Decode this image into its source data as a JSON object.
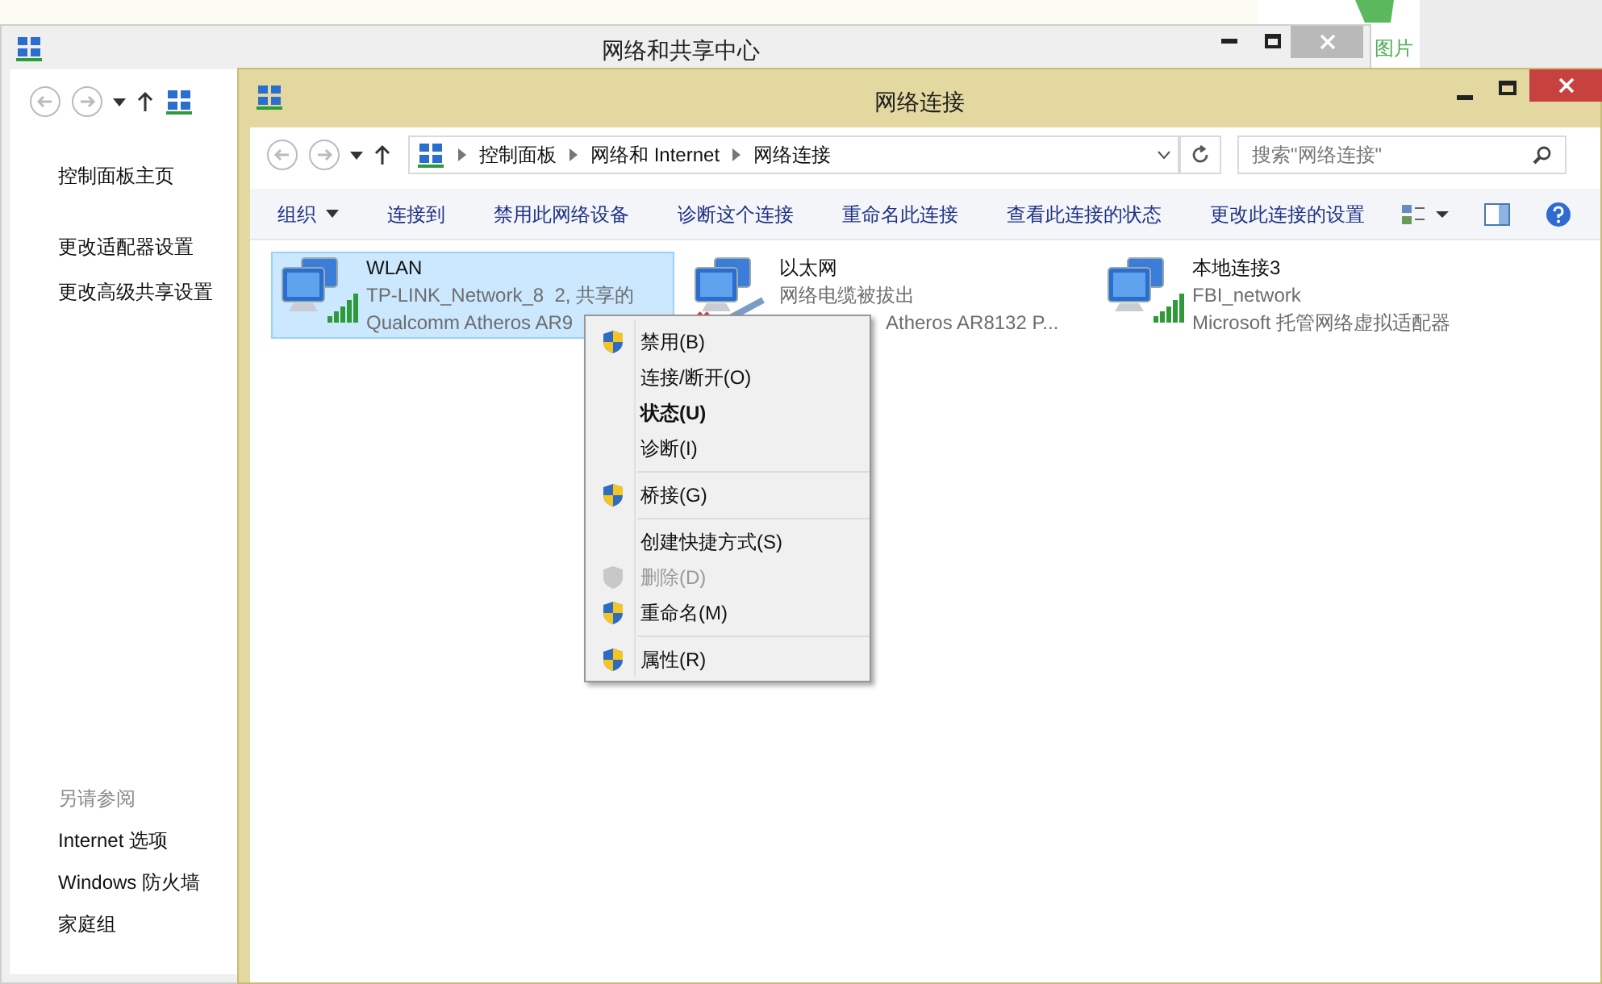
{
  "desktop": {
    "side_label": "图片"
  },
  "back_window": {
    "title": "网络和共享中心",
    "links": [
      "控制面板主页",
      "更改适配器设置",
      "更改高级共享设置"
    ],
    "see_also_heading": "另请参阅",
    "see_also": [
      "Internet 选项",
      "Windows 防火墙",
      "家庭组"
    ]
  },
  "window": {
    "title": "网络连接",
    "breadcrumb": [
      "控制面板",
      "网络和 Internet",
      "网络连接"
    ],
    "search": {
      "placeholder": "搜索\"网络连接\""
    },
    "toolbar": [
      {
        "label": "组织",
        "dropdown": true
      },
      {
        "label": "连接到",
        "dropdown": false
      },
      {
        "label": "禁用此网络设备",
        "dropdown": false
      },
      {
        "label": "诊断这个连接",
        "dropdown": false
      },
      {
        "label": "重命名此连接",
        "dropdown": false
      },
      {
        "label": "查看此连接的状态",
        "dropdown": false
      },
      {
        "label": "更改此连接的设置",
        "dropdown": false
      }
    ],
    "connections": [
      {
        "name": "WLAN",
        "status": "TP-LINK_Network_8  2, 共享的",
        "adapter": "Qualcomm Atheros AR9",
        "kind": "wireless",
        "selected": true
      },
      {
        "name": "以太网",
        "status": "网络电缆被拔出",
        "adapter": "Atheros AR8132 P...",
        "kind": "unplugged",
        "selected": false
      },
      {
        "name": "本地连接3",
        "status": "FBI_network",
        "adapter": "Microsoft 托管网络虚拟适配器",
        "kind": "wireless",
        "selected": false
      }
    ]
  },
  "context_menu": {
    "groups": [
      [
        {
          "label": "禁用(B)",
          "shield": true,
          "default": false,
          "disabled": false
        },
        {
          "label": "连接/断开(O)",
          "shield": false,
          "default": false,
          "disabled": false
        },
        {
          "label": "状态(U)",
          "shield": false,
          "default": true,
          "disabled": false
        },
        {
          "label": "诊断(I)",
          "shield": false,
          "default": false,
          "disabled": false
        }
      ],
      [
        {
          "label": "桥接(G)",
          "shield": true,
          "default": false,
          "disabled": false
        }
      ],
      [
        {
          "label": "创建快捷方式(S)",
          "shield": false,
          "default": false,
          "disabled": false
        },
        {
          "label": "删除(D)",
          "shield": true,
          "default": false,
          "disabled": true
        },
        {
          "label": "重命名(M)",
          "shield": true,
          "default": false,
          "disabled": false
        }
      ],
      [
        {
          "label": "属性(R)",
          "shield": true,
          "default": false,
          "disabled": false
        }
      ]
    ]
  }
}
